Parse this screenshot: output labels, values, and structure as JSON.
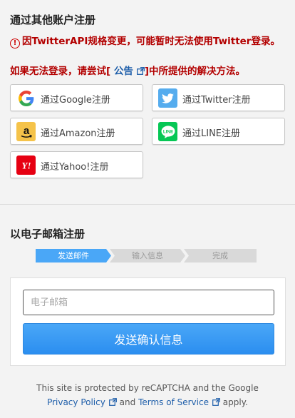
{
  "sns_section": {
    "title": "通过其他账户注册",
    "warning_line1": "因TwitterAPI规格变更，可能暂时无法使用Twitter登录。",
    "warning_line2_prefix": "如果无法登录，请尝试[",
    "warning_link": "公告",
    "warning_line2_suffix": "]中所提供的解决方法。",
    "buttons": [
      {
        "label": "通过Google注册",
        "icon": "google-icon"
      },
      {
        "label": "通过Twitter注册",
        "icon": "twitter-icon",
        "color": "#55acee"
      },
      {
        "label": "通过Amazon注册",
        "icon": "amazon-icon",
        "color": "#f5c34a"
      },
      {
        "label": "通过LINE注册",
        "icon": "line-icon",
        "color": "#06c755"
      },
      {
        "label": "通过Yahoo!注册",
        "icon": "yahoo-icon",
        "color": "#e60012"
      }
    ]
  },
  "email_section": {
    "title": "以电子邮箱注册",
    "steps": [
      "发送邮件",
      "输入信息",
      "完成"
    ],
    "active_step": 0,
    "email_placeholder": "电子邮箱",
    "submit_label": "发送确认信息"
  },
  "recaptcha": {
    "text1": "This site is protected by reCAPTCHA and the Google",
    "privacy_label": "Privacy Policy",
    "and": "and",
    "terms_label": "Terms of Service",
    "apply": "apply."
  },
  "colors": {
    "accent": "#2b8ef0",
    "warning": "#b30000",
    "link": "#1f5faa",
    "step_active": "#4aa7f7",
    "step_inactive": "#d9d9d9"
  }
}
